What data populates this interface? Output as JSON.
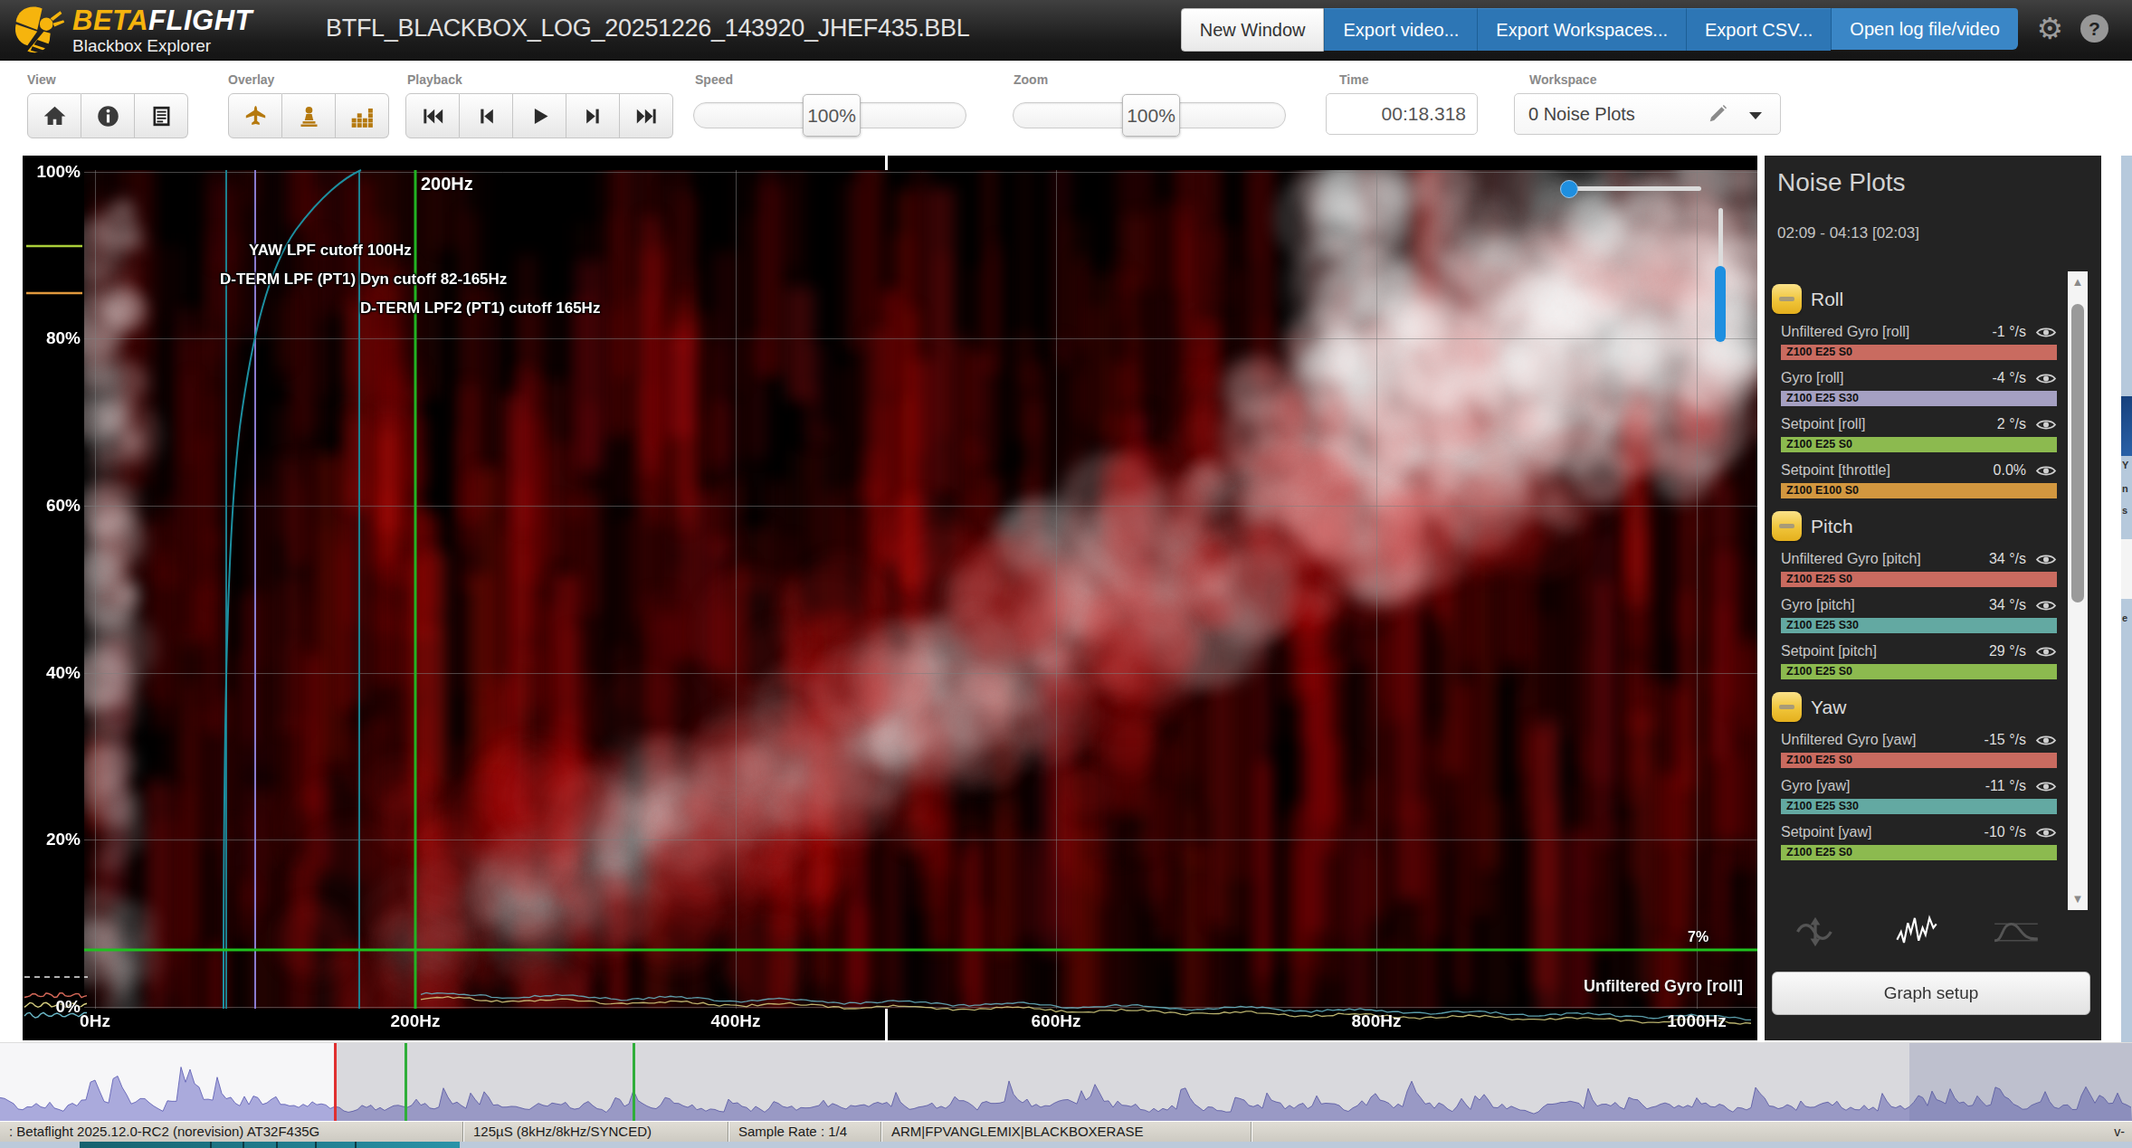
{
  "titlebar": {
    "logo": {
      "accent": "BETA",
      "rest": "FLIGHT",
      "subtitle": "Blackbox Explorer"
    },
    "filename": "BTFL_BLACKBOX_LOG_20251226_143920_JHEF435.BBL",
    "buttons": [
      {
        "label": "New Window"
      },
      {
        "label": "Export video..."
      },
      {
        "label": "Export Workspaces..."
      },
      {
        "label": "Export CSV..."
      },
      {
        "label": "Open log file/video"
      }
    ],
    "icons": [
      "gear",
      "help"
    ],
    "help_glyph": "?"
  },
  "toolbar": {
    "view": {
      "label": "View",
      "icons": [
        "home",
        "info",
        "log-fields"
      ]
    },
    "overlay": {
      "label": "Overlay",
      "icons": [
        "craft-plane",
        "sticks",
        "analyser"
      ]
    },
    "playback": {
      "label": "Playback",
      "icons": [
        "skip-start",
        "prev-frame",
        "play",
        "next-frame",
        "skip-end"
      ]
    },
    "speed": {
      "label": "Speed",
      "value": "100%"
    },
    "zoom": {
      "label": "Zoom",
      "value": "100%"
    },
    "time": {
      "label": "Time",
      "value": "00:18.318"
    },
    "workspace": {
      "label": "Workspace",
      "value": "0 Noise Plots"
    }
  },
  "graph": {
    "y_ticks": [
      "100%",
      "80%",
      "60%",
      "40%",
      "20%",
      "0%"
    ],
    "x_ticks": [
      "0Hz",
      "200Hz",
      "400Hz",
      "600Hz",
      "800Hz",
      "1000Hz"
    ],
    "marker_label": "200Hz",
    "annotations": [
      "YAW LPF cutoff 100Hz",
      "D-TERM LPF (PT1) Dyn cutoff 82-165Hz",
      "D-TERM LPF2 (PT1) cutoff 165Hz"
    ],
    "threshold_label": "7%",
    "field_label": "Unfiltered Gyro [roll]"
  },
  "sidebar": {
    "title": "Noise Plots",
    "time_range": "02:09 - 04:13 [02:03]",
    "groups": [
      {
        "name": "Roll",
        "fields": [
          {
            "label": "Unfiltered Gyro [roll]",
            "value": "-1 °/s",
            "badge": "Z100 E25 S0",
            "color": "#c96b60"
          },
          {
            "label": "Gyro [roll]",
            "value": "-4 °/s",
            "badge": "Z100 E25 S30",
            "color": "#a5a0c2"
          },
          {
            "label": "Setpoint [roll]",
            "value": "2 °/s",
            "badge": "Z100 E25 S0",
            "color": "#8cba4f"
          },
          {
            "label": "Setpoint [throttle]",
            "value": "0.0%",
            "badge": "Z100 E100 S0",
            "color": "#d2973f"
          }
        ]
      },
      {
        "name": "Pitch",
        "fields": [
          {
            "label": "Unfiltered Gyro [pitch]",
            "value": "34 °/s",
            "badge": "Z100 E25 S0",
            "color": "#c96b60"
          },
          {
            "label": "Gyro [pitch]",
            "value": "34 °/s",
            "badge": "Z100 E25 S30",
            "color": "#63a9a2"
          },
          {
            "label": "Setpoint [pitch]",
            "value": "29 °/s",
            "badge": "Z100 E25 S0",
            "color": "#8cba4f"
          }
        ]
      },
      {
        "name": "Yaw",
        "fields": [
          {
            "label": "Unfiltered Gyro [yaw]",
            "value": "-15 °/s",
            "badge": "Z100 E25 S0",
            "color": "#c96b60"
          },
          {
            "label": "Gyro [yaw]",
            "value": "-11 °/s",
            "badge": "Z100 E25 S30",
            "color": "#63a9a2"
          },
          {
            "label": "Setpoint [yaw]",
            "value": "-10 °/s",
            "badge": "Z100 E25 S0",
            "color": "#8cba4f"
          }
        ]
      }
    ],
    "footer_icons": [
      "stick-response",
      "noise",
      "step-response"
    ],
    "graph_setup": "Graph setup"
  },
  "statusbar": {
    "segments": [
      ": Betaflight 2025.12.0-RC2 (norevision) AT32F435G",
      "125µS (8kHz/8kHz/SYNCED)",
      "Sample Rate : 1/4",
      "ARM|FPVANGLEMIX|BLACKBOXERASE"
    ],
    "right": "v-"
  },
  "edge_window": {
    "letters": [
      "Y",
      "n",
      "s",
      "e"
    ]
  }
}
